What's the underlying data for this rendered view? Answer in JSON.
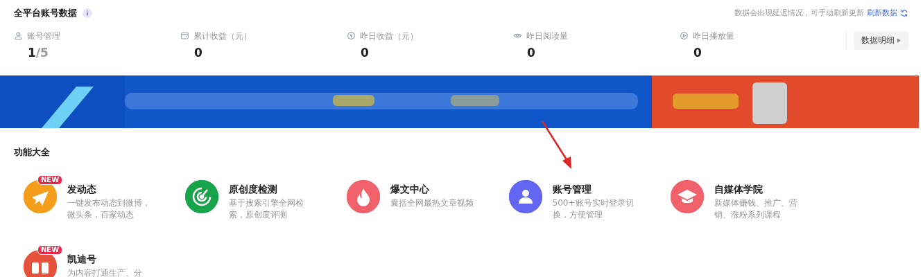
{
  "header": {
    "title": "全平台账号数据",
    "notice": "数据会出现延迟情况，可手动刷新更新",
    "refresh_link": "刷新数据"
  },
  "stats": [
    {
      "kind": "user",
      "label": "账号管理",
      "value": "1",
      "total": "/5"
    },
    {
      "kind": "wallet",
      "label": "累计收益（元）",
      "value": "0"
    },
    {
      "kind": "coin",
      "label": "昨日收益（元）",
      "value": "0"
    },
    {
      "kind": "eye",
      "label": "昨日阅读量",
      "value": "0"
    },
    {
      "kind": "play",
      "label": "昨日播放量",
      "value": "0"
    }
  ],
  "details_button": "数据明细",
  "features": {
    "title": "功能大全",
    "items": [
      {
        "kind": "plane",
        "color": "#f59e1b",
        "title": "发动态",
        "badge": "NEW",
        "desc": "一键发布动态到微博，微头条，百家动态"
      },
      {
        "kind": "radar",
        "color": "#16a34a",
        "title": "原创度检测",
        "desc": "基于搜索引擎全网检索，原创度评测"
      },
      {
        "kind": "fire",
        "color": "#f0616b",
        "title": "爆文中心",
        "desc": "囊括全网最热文章视频"
      },
      {
        "kind": "person",
        "color": "#6366f1",
        "title": "账号管理",
        "desc": "500+账号实时登录切换，方便管理"
      },
      {
        "kind": "cap",
        "color": "#f0616b",
        "title": "自媒体学院",
        "desc": "新媒体赚钱、推广、营销、涨粉系列课程"
      },
      {
        "kind": "logo",
        "color": "#e5533d",
        "title": "凯迪号",
        "badge": "NEW",
        "desc": "为内容打通生产、分"
      }
    ]
  }
}
